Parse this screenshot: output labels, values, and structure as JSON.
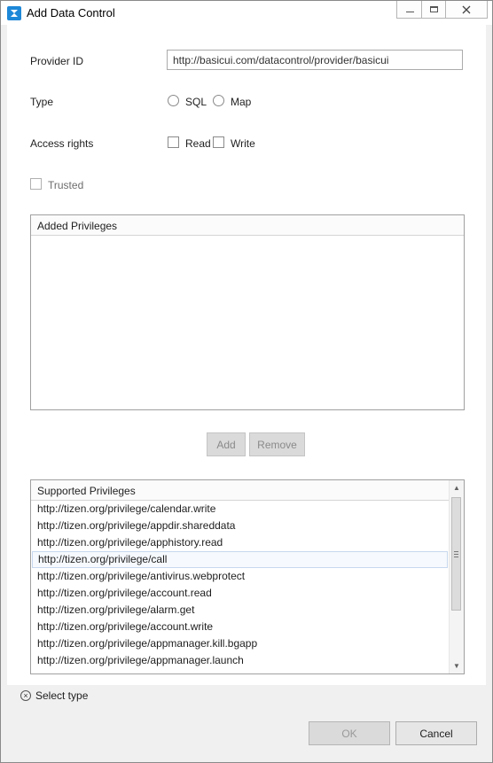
{
  "window": {
    "title": "Add Data Control",
    "controls": {
      "minimize": "minimize-icon",
      "maximize": "maximize-icon",
      "close": "close-icon"
    }
  },
  "form": {
    "provider_id_label": "Provider ID",
    "provider_id_value": "http://basicui.com/datacontrol/provider/basicui",
    "type_label": "Type",
    "type_options": [
      "SQL",
      "Map"
    ],
    "access_label": "Access rights",
    "access_options": [
      "Read",
      "Write"
    ],
    "trusted_label": "Trusted"
  },
  "added_privileges": {
    "header": "Added Privileges",
    "items": []
  },
  "buttons": {
    "add": "Add",
    "remove": "Remove",
    "ok": "OK",
    "cancel": "Cancel"
  },
  "supported_privileges": {
    "header": "Supported Privileges",
    "selected_index": 3,
    "items": [
      "http://tizen.org/privilege/calendar.write",
      "http://tizen.org/privilege/appdir.shareddata",
      "http://tizen.org/privilege/apphistory.read",
      "http://tizen.org/privilege/call",
      "http://tizen.org/privilege/antivirus.webprotect",
      "http://tizen.org/privilege/account.read",
      "http://tizen.org/privilege/alarm.get",
      "http://tizen.org/privilege/account.write",
      "http://tizen.org/privilege/appmanager.kill.bgapp",
      "http://tizen.org/privilege/appmanager.launch"
    ]
  },
  "status": {
    "icon": "error-circle-icon",
    "text": "Select type"
  },
  "colors": {
    "accent_icon": "#1e88d8",
    "selected_row": "#f6f9fd"
  }
}
